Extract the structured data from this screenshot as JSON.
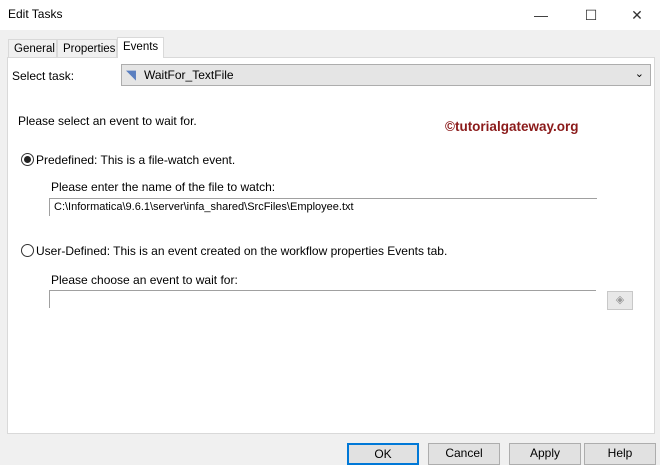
{
  "window": {
    "title": "Edit Tasks"
  },
  "tabs": [
    {
      "label": "General"
    },
    {
      "label": "Properties"
    },
    {
      "label": "Events"
    }
  ],
  "select_task": {
    "label": "Select task:",
    "value": "WaitFor_TextFile"
  },
  "prompt": "Please select an event to wait for.",
  "watermark": "©tutorialgateway.org",
  "predefined": {
    "label": "Predefined: This is a file-watch event.",
    "selected": true,
    "field_label": "Please enter the name of the file to watch:",
    "value": "C:\\Informatica\\9.6.1\\server\\infa_shared\\SrcFiles\\Employee.txt"
  },
  "user_defined": {
    "label": "User-Defined: This is an event created on the workflow properties Events tab.",
    "selected": false,
    "field_label": "Please choose an event to wait for:",
    "value": ""
  },
  "buttons": {
    "ok": "OK",
    "cancel": "Cancel",
    "apply": "Apply",
    "help": "Help"
  }
}
